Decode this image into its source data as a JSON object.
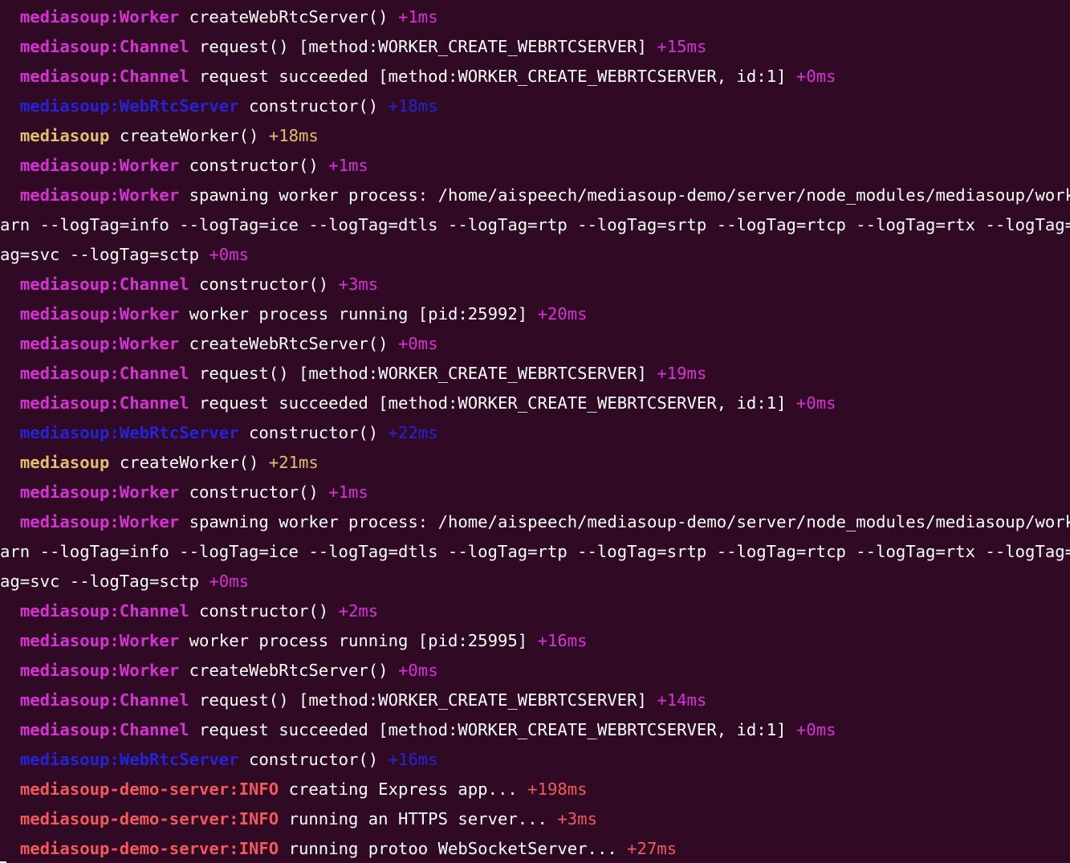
{
  "terminal": {
    "lines": [
      {
        "indent": "  ",
        "ns": "mediasoup:Worker",
        "color": "magenta",
        "msg": "createWebRtcServer()",
        "delta": "+1ms"
      },
      {
        "indent": "  ",
        "ns": "mediasoup:Channel",
        "color": "magenta",
        "msg": "request() [method:WORKER_CREATE_WEBRTCSERVER]",
        "delta": "+15ms"
      },
      {
        "indent": "  ",
        "ns": "mediasoup:Channel",
        "color": "magenta",
        "msg": "request succeeded [method:WORKER_CREATE_WEBRTCSERVER, id:1]",
        "delta": "+0ms"
      },
      {
        "indent": "  ",
        "ns": "mediasoup:WebRtcServer",
        "color": "blue",
        "msg": "constructor()",
        "delta": "+18ms"
      },
      {
        "indent": "  ",
        "ns": "mediasoup",
        "color": "yellow",
        "msg": "createWorker()",
        "delta": "+18ms"
      },
      {
        "indent": "  ",
        "ns": "mediasoup:Worker",
        "color": "magenta",
        "msg": "constructor()",
        "delta": "+1ms"
      },
      {
        "indent": "  ",
        "ns": "mediasoup:Worker",
        "color": "magenta",
        "msg": "spawning worker process: /home/aispeech/mediasoup-demo/server/node_modules/mediasoup/worker/",
        "delta": ""
      },
      {
        "indent": "",
        "ns": "",
        "color": "magenta",
        "msg": "arn --logTag=info --logTag=ice --logTag=dtls --logTag=rtp --logTag=srtp --logTag=rtcp --logTag=rtx --logTag=bwe",
        "delta": ""
      },
      {
        "indent": "",
        "ns": "",
        "color": "magenta",
        "msg": "ag=svc --logTag=sctp",
        "delta": "+0ms"
      },
      {
        "indent": "  ",
        "ns": "mediasoup:Channel",
        "color": "magenta",
        "msg": "constructor()",
        "delta": "+3ms"
      },
      {
        "indent": "  ",
        "ns": "mediasoup:Worker",
        "color": "magenta",
        "msg": "worker process running [pid:25992]",
        "delta": "+20ms"
      },
      {
        "indent": "  ",
        "ns": "mediasoup:Worker",
        "color": "magenta",
        "msg": "createWebRtcServer()",
        "delta": "+0ms"
      },
      {
        "indent": "  ",
        "ns": "mediasoup:Channel",
        "color": "magenta",
        "msg": "request() [method:WORKER_CREATE_WEBRTCSERVER]",
        "delta": "+19ms"
      },
      {
        "indent": "  ",
        "ns": "mediasoup:Channel",
        "color": "magenta",
        "msg": "request succeeded [method:WORKER_CREATE_WEBRTCSERVER, id:1]",
        "delta": "+0ms"
      },
      {
        "indent": "  ",
        "ns": "mediasoup:WebRtcServer",
        "color": "blue",
        "msg": "constructor()",
        "delta": "+22ms"
      },
      {
        "indent": "  ",
        "ns": "mediasoup",
        "color": "yellow",
        "msg": "createWorker()",
        "delta": "+21ms"
      },
      {
        "indent": "  ",
        "ns": "mediasoup:Worker",
        "color": "magenta",
        "msg": "constructor()",
        "delta": "+1ms"
      },
      {
        "indent": "  ",
        "ns": "mediasoup:Worker",
        "color": "magenta",
        "msg": "spawning worker process: /home/aispeech/mediasoup-demo/server/node_modules/mediasoup/worker/",
        "delta": ""
      },
      {
        "indent": "",
        "ns": "",
        "color": "magenta",
        "msg": "arn --logTag=info --logTag=ice --logTag=dtls --logTag=rtp --logTag=srtp --logTag=rtcp --logTag=rtx --logTag=bwe",
        "delta": ""
      },
      {
        "indent": "",
        "ns": "",
        "color": "magenta",
        "msg": "ag=svc --logTag=sctp",
        "delta": "+0ms"
      },
      {
        "indent": "  ",
        "ns": "mediasoup:Channel",
        "color": "magenta",
        "msg": "constructor()",
        "delta": "+2ms"
      },
      {
        "indent": "  ",
        "ns": "mediasoup:Worker",
        "color": "magenta",
        "msg": "worker process running [pid:25995]",
        "delta": "+16ms"
      },
      {
        "indent": "  ",
        "ns": "mediasoup:Worker",
        "color": "magenta",
        "msg": "createWebRtcServer()",
        "delta": "+0ms"
      },
      {
        "indent": "  ",
        "ns": "mediasoup:Channel",
        "color": "magenta",
        "msg": "request() [method:WORKER_CREATE_WEBRTCSERVER]",
        "delta": "+14ms"
      },
      {
        "indent": "  ",
        "ns": "mediasoup:Channel",
        "color": "magenta",
        "msg": "request succeeded [method:WORKER_CREATE_WEBRTCSERVER, id:1]",
        "delta": "+0ms"
      },
      {
        "indent": "  ",
        "ns": "mediasoup:WebRtcServer",
        "color": "blue",
        "msg": "constructor()",
        "delta": "+16ms"
      },
      {
        "indent": "  ",
        "ns": "mediasoup-demo-server:INFO",
        "color": "red",
        "msg": "creating Express app...",
        "delta": "+198ms"
      },
      {
        "indent": "  ",
        "ns": "mediasoup-demo-server:INFO",
        "color": "red",
        "msg": "running an HTTPS server...",
        "delta": "+3ms"
      },
      {
        "indent": "  ",
        "ns": "mediasoup-demo-server:INFO",
        "color": "red",
        "msg": "running protoo WebSocketServer...",
        "delta": "+27ms"
      }
    ]
  },
  "colors": {
    "background": "#300a24",
    "text": "#ffffff",
    "magenta": "#d633d6",
    "blue": "#2424d6",
    "yellow": "#e1bf6c",
    "red": "#f05a5a"
  }
}
